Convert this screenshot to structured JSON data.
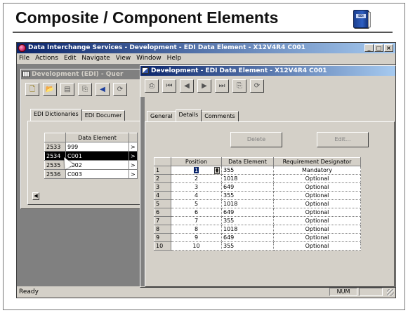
{
  "slide": {
    "title": "Composite / Component Elements"
  },
  "app": {
    "title": "Data Interchange Services - Development - EDI Data Element - X12V4R4  C001",
    "menu": [
      "File",
      "Actions",
      "Edit",
      "Navigate",
      "View",
      "Window",
      "Help"
    ]
  },
  "query_window": {
    "title": "Development (EDI) - Quer",
    "tabs": [
      "EDI Dictionaries",
      "EDI Documer"
    ],
    "grid_header": "Data Element",
    "rows": [
      {
        "num": "2533",
        "value": "999",
        "selected": false
      },
      {
        "num": "2534",
        "value": "C001",
        "selected": true
      },
      {
        "num": "2535",
        "value": "C002",
        "selected": false
      },
      {
        "num": "2536",
        "value": "C003",
        "selected": false
      }
    ]
  },
  "element_window": {
    "title": "Development - EDI Data Element - X12V4R4  C001",
    "tabs": [
      "General",
      "Details",
      "Comments"
    ],
    "selected_tab": "Details",
    "buttons": {
      "delete": "Delete",
      "edit": "Edit..."
    },
    "columns": [
      "Position",
      "Data Element",
      "Requirement Designator"
    ],
    "rows": [
      {
        "n": "1",
        "position": "1",
        "element": "355",
        "designator": "Mandatory"
      },
      {
        "n": "2",
        "position": "2",
        "element": "1018",
        "designator": "Optional"
      },
      {
        "n": "3",
        "position": "3",
        "element": "649",
        "designator": "Optional"
      },
      {
        "n": "4",
        "position": "4",
        "element": "355",
        "designator": "Optional"
      },
      {
        "n": "5",
        "position": "5",
        "element": "1018",
        "designator": "Optional"
      },
      {
        "n": "6",
        "position": "6",
        "element": "649",
        "designator": "Optional"
      },
      {
        "n": "7",
        "position": "7",
        "element": "355",
        "designator": "Optional"
      },
      {
        "n": "8",
        "position": "8",
        "element": "1018",
        "designator": "Optional"
      },
      {
        "n": "9",
        "position": "9",
        "element": "649",
        "designator": "Optional"
      },
      {
        "n": "10",
        "position": "10",
        "element": "355",
        "designator": "Optional"
      }
    ]
  },
  "status": {
    "text": "Ready",
    "num": "NUM"
  },
  "colors": {
    "title_active": "#0a246a",
    "title_inactive": "#808080",
    "face": "#d4d0c8",
    "mdi": "#808080"
  }
}
